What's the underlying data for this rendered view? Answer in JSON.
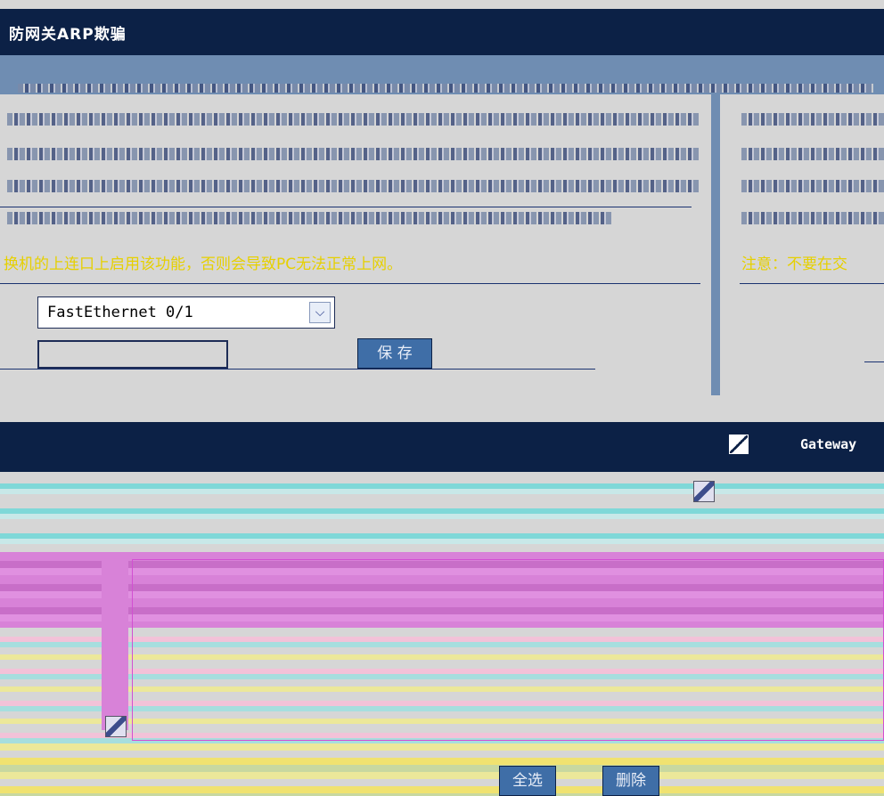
{
  "window": {
    "title": "防网关ARP欺骗"
  },
  "left_panel": {
    "warning": "换机的上连口上启用该功能，否则会导致PC无法正常上网。",
    "port_select": {
      "selected": "FastEthernet 0/1"
    },
    "gateway_input": {
      "value": ""
    },
    "save_button": "保 存"
  },
  "right_panel": {
    "warning": "注意：不要在交"
  },
  "table": {
    "columns": [
      "Gateway"
    ]
  },
  "actions": {
    "select_all": "全选",
    "delete": "删除"
  },
  "colors": {
    "header_bg": "#0c2146",
    "accent": "#6f8db2",
    "button_bg": "#3f6ea7",
    "warning": "#e6d000"
  }
}
